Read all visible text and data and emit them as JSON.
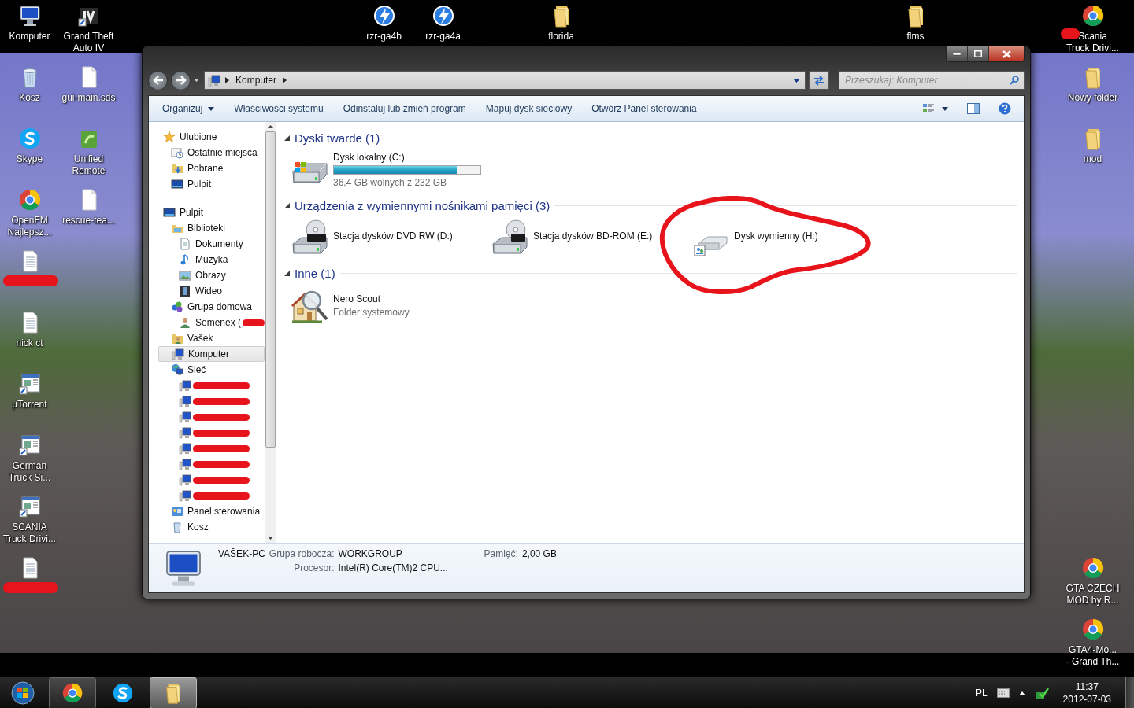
{
  "desktop": {
    "icons": [
      {
        "label": "Komputer",
        "kind": "computer",
        "redacted": false
      },
      {
        "label": "Grand Theft\nAuto IV",
        "kind": "game",
        "redacted": false
      },
      {
        "label": "rzr-ga4b",
        "kind": "lightning",
        "redacted": false
      },
      {
        "label": "rzr-ga4a",
        "kind": "lightning",
        "redacted": false
      },
      {
        "label": "florida",
        "kind": "folder",
        "redacted": false
      },
      {
        "label": "flms",
        "kind": "folder",
        "redacted": false
      },
      {
        "label": "Scania\nTruck Drivi...",
        "kind": "browser",
        "redacted": true
      },
      {
        "label": "Kosz",
        "kind": "bin",
        "redacted": false
      },
      {
        "label": "gui-main.sds",
        "kind": "document",
        "redacted": false
      },
      {
        "label": "Nowy folder",
        "kind": "folder",
        "redacted": false
      },
      {
        "label": "Skype",
        "kind": "chat",
        "redacted": false
      },
      {
        "label": "Unified\nRemote",
        "kind": "app",
        "redacted": false
      },
      {
        "label": "mod",
        "kind": "folder",
        "redacted": false
      },
      {
        "label": "OpenFM\nNajlepsz...",
        "kind": "browser",
        "redacted": false
      },
      {
        "label": "rescue-tea...",
        "kind": "document",
        "redacted": false
      },
      {
        "kind": "text-file",
        "redacted": true
      },
      {
        "label": "nick ct",
        "kind": "text-file",
        "redacted": false
      },
      {
        "label": "µTorrent",
        "kind": "window-app",
        "redacted": false
      },
      {
        "label": "German\nTruck Si...",
        "kind": "window-app",
        "redacted": false
      },
      {
        "label": "SCANIA\nTruck Drivi...",
        "kind": "window-app",
        "redacted": false
      },
      {
        "kind": "text-file",
        "redacted": true
      },
      {
        "label": "GTA CZECH\nMOD by R...",
        "kind": "browser",
        "redacted": false
      },
      {
        "label": "GTA4-Mo...\n- Grand Th...",
        "kind": "browser",
        "redacted": false
      }
    ]
  },
  "window": {
    "breadcrumb": [
      "Komputer"
    ],
    "search": {
      "placeholder": "Przeszukaj: Komputer"
    },
    "toolbar": [
      {
        "label": "Organizuj",
        "dropdown": true
      },
      {
        "label": "Właściwości systemu",
        "dropdown": false
      },
      {
        "label": "Odinstaluj lub zmień program",
        "dropdown": false
      },
      {
        "label": "Mapuj dysk sieciowy",
        "dropdown": false
      },
      {
        "label": "Otwórz Panel sterowania",
        "dropdown": false
      }
    ],
    "nav_pane": {
      "items": [
        {
          "label": "Ulubione",
          "kind": "star",
          "selected": false,
          "redacted": false,
          "children": [
            {
              "label": "Ostatnie miejsca",
              "kind": "recent",
              "selected": false,
              "redacted": false
            },
            {
              "label": "Pobrane",
              "kind": "download",
              "selected": false,
              "redacted": false
            },
            {
              "label": "Pulpit",
              "kind": "desktop",
              "selected": false,
              "redacted": false
            }
          ]
        },
        {
          "label": "Pulpit",
          "kind": "desktop",
          "selected": false,
          "redacted": false,
          "children": [
            {
              "label": "Biblioteki",
              "kind": "library",
              "selected": false,
              "redacted": false,
              "children": [
                {
                  "label": "Dokumenty",
                  "kind": "document",
                  "selected": false,
                  "redacted": false
                },
                {
                  "label": "Muzyka",
                  "kind": "music",
                  "selected": false,
                  "redacted": false
                },
                {
                  "label": "Obrazy",
                  "kind": "picture",
                  "selected": false,
                  "redacted": false
                },
                {
                  "label": "Wideo",
                  "kind": "video",
                  "selected": false,
                  "redacted": false
                }
              ]
            },
            {
              "label": "Grupa domowa",
              "kind": "homegroup",
              "selected": false,
              "redacted": false,
              "children": [
                {
                  "label": "Semenex (",
                  "kind": "user",
                  "selected": false,
                  "redacted": true
                }
              ]
            },
            {
              "label": "Vašek",
              "kind": "user-folder",
              "selected": false,
              "redacted": false
            },
            {
              "label": "Komputer",
              "kind": "computer",
              "selected": true,
              "redacted": false
            },
            {
              "label": "Sieć",
              "kind": "network",
              "selected": false,
              "redacted": false,
              "children": [
                {
                  "kind": "computer",
                  "selected": false,
                  "redacted": true
                },
                {
                  "kind": "computer",
                  "selected": false,
                  "redacted": true
                },
                {
                  "kind": "computer",
                  "selected": false,
                  "redacted": true
                },
                {
                  "kind": "computer",
                  "selected": false,
                  "redacted": true
                },
                {
                  "kind": "computer",
                  "selected": false,
                  "redacted": true
                },
                {
                  "kind": "computer",
                  "selected": false,
                  "redacted": true
                },
                {
                  "kind": "computer",
                  "selected": false,
                  "redacted": true
                },
                {
                  "kind": "computer",
                  "selected": false,
                  "redacted": true
                }
              ]
            },
            {
              "label": "Panel sterowania",
              "kind": "control-panel",
              "selected": false,
              "redacted": false
            },
            {
              "label": "Kosz",
              "kind": "bin",
              "selected": false,
              "redacted": false
            }
          ]
        }
      ]
    },
    "groups": [
      {
        "title": "Dyski twarde (1)",
        "expanded": true,
        "items": [
          {
            "kind": "hard-disk",
            "name": "Dysk lokalny (C:)",
            "level": 0.84,
            "info": "36,4 GB wolnych z 232 GB",
            "highlighted": false
          }
        ]
      },
      {
        "title": "Urządzenia z wymiennymi nośnikami pamięci (3)",
        "expanded": true,
        "items": [
          {
            "kind": "dvd",
            "name": "Stacja dysków DVD RW (D:)",
            "highlighted": false
          },
          {
            "kind": "bd",
            "name": "Stacja dysków BD-ROM (E:)",
            "highlighted": false
          },
          {
            "kind": "removable",
            "name": "Dysk wymienny (H:)",
            "highlighted": true
          }
        ]
      },
      {
        "title": "Inne (1)",
        "expanded": true,
        "items": [
          {
            "kind": "system-folder",
            "name": "Nero Scout",
            "info": "Folder systemowy",
            "highlighted": false
          }
        ]
      }
    ],
    "details": {
      "name": "VAŠEK-PC",
      "fields": [
        {
          "label": "Grupa robocza:",
          "value": "WORKGROUP"
        },
        {
          "label": "Pamięć:",
          "value": "2,00 GB"
        },
        {
          "label": "Procesor:",
          "value": "Intel(R) Core(TM)2 CPU..."
        }
      ]
    }
  },
  "taskbar": {
    "buttons": [
      {
        "kind": "browser",
        "running": true,
        "active": false
      },
      {
        "kind": "chat",
        "running": false,
        "active": false
      },
      {
        "kind": "explorer",
        "running": true,
        "active": true
      }
    ],
    "language": "PL",
    "clock": {
      "time": "11:37",
      "date": "2012-07-03"
    }
  }
}
